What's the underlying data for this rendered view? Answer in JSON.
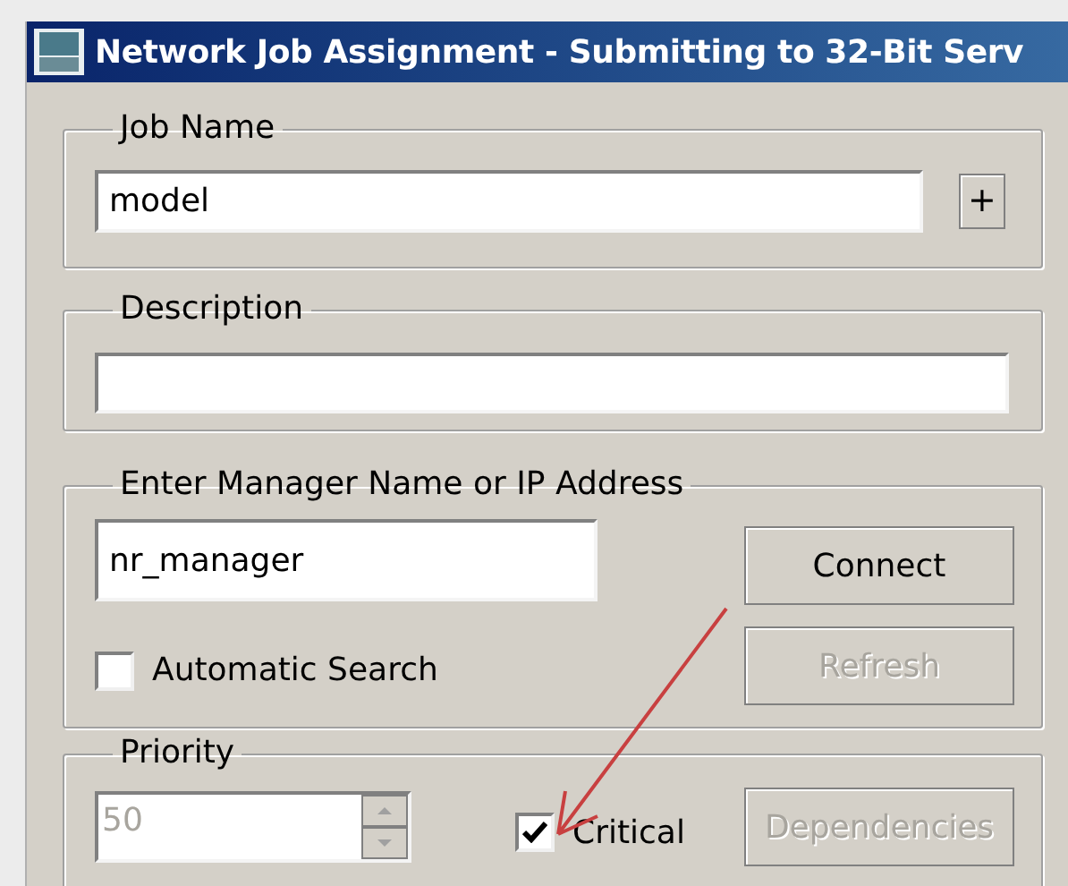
{
  "window": {
    "title": "Network Job Assignment - Submitting to 32-Bit Serv"
  },
  "job_name": {
    "label": "Job Name",
    "value": "model",
    "add_button": "+"
  },
  "description": {
    "label": "Description"
  },
  "manager": {
    "label": "Enter Manager Name or IP Address",
    "value": "nr_manager",
    "connect_button": {
      "label": "Connect",
      "disabled": false
    },
    "refresh_button": {
      "label": "Refresh",
      "disabled": true
    },
    "automatic_search": {
      "label": "Automatic Search",
      "checked": false
    }
  },
  "priority": {
    "label": "Priority",
    "value": "50",
    "disabled": true,
    "critical": {
      "label": "Critical",
      "checked": true
    },
    "dependencies_button": {
      "label": "Dependencies",
      "disabled": true
    }
  }
}
